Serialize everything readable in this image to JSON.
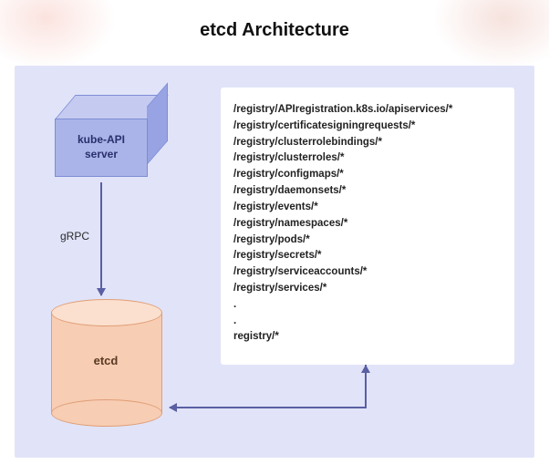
{
  "title": "etcd Architecture",
  "kube_api_label": "kube-API\nserver",
  "protocol_label": "gRPC",
  "etcd_label": "etcd",
  "registry_paths": [
    "/registry/APIregistration.k8s.io/apiservices/*",
    "/registry/certificatesigningrequests/*",
    "/registry/clusterrolebindings/*",
    "/registry/clusterroles/*",
    "/registry/configmaps/*",
    "/registry/daemonsets/*",
    "/registry/events/*",
    "/registry/namespaces/*",
    "/registry/pods/*",
    "/registry/secrets/*",
    "/registry/serviceaccounts/*",
    "/registry/services/*",
    ".",
    ".",
    "registry/*"
  ]
}
